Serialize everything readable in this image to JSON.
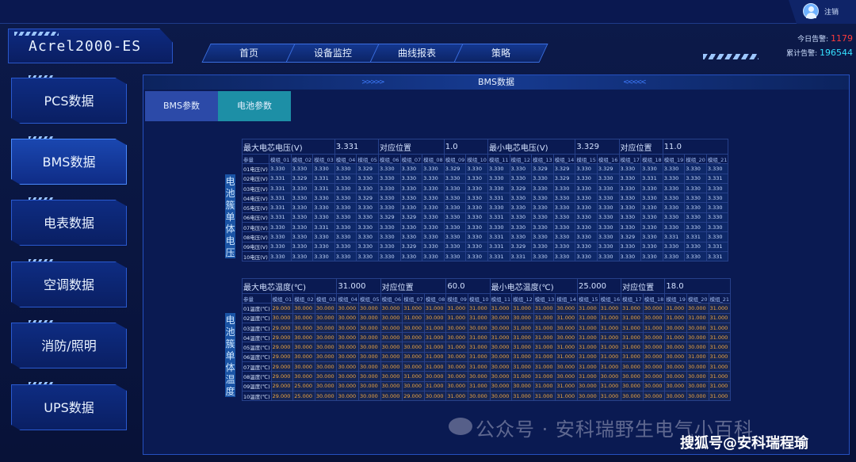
{
  "app": {
    "title": "Acrel2000-ES",
    "logout": "注销"
  },
  "nav": [
    "首页",
    "设备监控",
    "曲线报表",
    "策略"
  ],
  "alarms": {
    "today_label": "今日告警:",
    "today_value": "1179",
    "total_label": "累计告警:",
    "total_value": "196544"
  },
  "sidebar": [
    "PCS数据",
    "BMS数据",
    "电表数据",
    "空调数据",
    "消防/照明",
    "UPS数据"
  ],
  "sidebar_active": 1,
  "panel": {
    "title": "BMS数据",
    "tabs": [
      "BMS参数",
      "电池参数"
    ]
  },
  "voltage": {
    "vlabel": "电池簇单体电压",
    "summary": {
      "max_label": "最大电芯电压(V)",
      "max_value": "3.331",
      "max_pos_label": "对应位置",
      "max_pos": "1.0",
      "min_label": "最小电芯电压(V)",
      "min_value": "3.329",
      "min_pos_label": "对应位置",
      "min_pos": "11.0"
    },
    "corner": "参量",
    "columns": [
      "模组_01",
      "模组_02",
      "模组_03",
      "模组_04",
      "模组_05",
      "模组_06",
      "模组_07",
      "模组_08",
      "模组_09",
      "模组_10",
      "模组_11",
      "模组_12",
      "模组_13",
      "模组_14",
      "模组_15",
      "模组_16",
      "模组_17",
      "模组_18",
      "模组_19",
      "模组_20",
      "模组_21"
    ],
    "rows": [
      {
        "label": "01电压(V)",
        "values": [
          "3.330",
          "3.330",
          "3.330",
          "3.330",
          "3.329",
          "3.330",
          "3.330",
          "3.330",
          "3.329",
          "3.330",
          "3.330",
          "3.330",
          "3.329",
          "3.329",
          "3.330",
          "3.329",
          "3.330",
          "3.330",
          "3.330",
          "3.330",
          "3.330"
        ]
      },
      {
        "label": "02电压(V)",
        "values": [
          "3.331",
          "3.329",
          "3.331",
          "3.330",
          "3.330",
          "3.330",
          "3.330",
          "3.330",
          "3.330",
          "3.330",
          "3.330",
          "3.330",
          "3.330",
          "3.329",
          "3.330",
          "3.330",
          "3.330",
          "3.331",
          "3.330",
          "3.330",
          "3.331"
        ]
      },
      {
        "label": "03电压(V)",
        "values": [
          "3.331",
          "3.330",
          "3.331",
          "3.330",
          "3.330",
          "3.330",
          "3.330",
          "3.330",
          "3.330",
          "3.330",
          "3.330",
          "3.329",
          "3.330",
          "3.330",
          "3.330",
          "3.330",
          "3.330",
          "3.330",
          "3.330",
          "3.330",
          "3.330"
        ]
      },
      {
        "label": "04电压(V)",
        "values": [
          "3.331",
          "3.330",
          "3.330",
          "3.330",
          "3.329",
          "3.330",
          "3.330",
          "3.330",
          "3.330",
          "3.330",
          "3.331",
          "3.330",
          "3.330",
          "3.330",
          "3.330",
          "3.330",
          "3.330",
          "3.330",
          "3.330",
          "3.330",
          "3.330"
        ]
      },
      {
        "label": "05电压(V)",
        "values": [
          "3.331",
          "3.330",
          "3.330",
          "3.330",
          "3.330",
          "3.330",
          "3.330",
          "3.330",
          "3.330",
          "3.330",
          "3.330",
          "3.330",
          "3.330",
          "3.330",
          "3.330",
          "3.330",
          "3.330",
          "3.330",
          "3.330",
          "3.330",
          "3.330"
        ]
      },
      {
        "label": "06电压(V)",
        "values": [
          "3.331",
          "3.330",
          "3.330",
          "3.330",
          "3.330",
          "3.329",
          "3.329",
          "3.330",
          "3.330",
          "3.330",
          "3.331",
          "3.330",
          "3.330",
          "3.330",
          "3.330",
          "3.330",
          "3.330",
          "3.330",
          "3.330",
          "3.330",
          "3.330"
        ]
      },
      {
        "label": "07电压(V)",
        "values": [
          "3.330",
          "3.330",
          "3.331",
          "3.330",
          "3.330",
          "3.330",
          "3.330",
          "3.330",
          "3.330",
          "3.330",
          "3.330",
          "3.330",
          "3.330",
          "3.330",
          "3.330",
          "3.330",
          "3.330",
          "3.330",
          "3.330",
          "3.330",
          "3.330"
        ]
      },
      {
        "label": "08电压(V)",
        "values": [
          "3.330",
          "3.330",
          "3.330",
          "3.330",
          "3.330",
          "3.330",
          "3.330",
          "3.330",
          "3.330",
          "3.330",
          "3.331",
          "3.330",
          "3.330",
          "3.330",
          "3.330",
          "3.330",
          "3.329",
          "3.330",
          "3.331",
          "3.331",
          "3.330"
        ]
      },
      {
        "label": "09电压(V)",
        "values": [
          "3.330",
          "3.330",
          "3.330",
          "3.330",
          "3.330",
          "3.330",
          "3.329",
          "3.330",
          "3.330",
          "3.330",
          "3.331",
          "3.329",
          "3.330",
          "3.330",
          "3.330",
          "3.330",
          "3.330",
          "3.330",
          "3.330",
          "3.330",
          "3.331"
        ]
      },
      {
        "label": "10电压(V)",
        "values": [
          "3.330",
          "3.330",
          "3.330",
          "3.330",
          "3.330",
          "3.330",
          "3.330",
          "3.330",
          "3.330",
          "3.330",
          "3.331",
          "3.331",
          "3.330",
          "3.330",
          "3.330",
          "3.330",
          "3.330",
          "3.330",
          "3.330",
          "3.330",
          "3.331"
        ]
      }
    ]
  },
  "temperature": {
    "vlabel": "电池簇单体温度",
    "summary": {
      "max_label": "最大电芯温度(℃)",
      "max_value": "31.000",
      "max_pos_label": "对应位置",
      "max_pos": "60.0",
      "min_label": "最小电芯温度(℃)",
      "min_value": "25.000",
      "min_pos_label": "对应位置",
      "min_pos": "18.0"
    },
    "corner": "参量",
    "columns": [
      "模组_01",
      "模组_02",
      "模组_03",
      "模组_04",
      "模组_05",
      "模组_06",
      "模组_07",
      "模组_08",
      "模组_09",
      "模组_10",
      "模组_11",
      "模组_12",
      "模组_13",
      "模组_14",
      "模组_15",
      "模组_16",
      "模组_17",
      "模组_18",
      "模组_19",
      "模组_20",
      "模组_21"
    ],
    "rows": [
      {
        "label": "01温度(℃)",
        "values": [
          "29.000",
          "30.000",
          "30.000",
          "30.000",
          "30.000",
          "30.000",
          "31.000",
          "31.000",
          "31.000",
          "31.000",
          "31.000",
          "31.000",
          "31.000",
          "30.000",
          "31.000",
          "31.000",
          "31.000",
          "30.000",
          "31.000",
          "30.000",
          "31.000"
        ]
      },
      {
        "label": "02温度(℃)",
        "values": [
          "30.000",
          "30.000",
          "30.000",
          "30.000",
          "30.000",
          "30.000",
          "31.000",
          "30.000",
          "31.000",
          "31.000",
          "30.000",
          "30.000",
          "31.000",
          "31.000",
          "31.000",
          "31.000",
          "31.000",
          "30.000",
          "31.000",
          "31.000",
          "31.000"
        ]
      },
      {
        "label": "03温度(℃)",
        "values": [
          "29.000",
          "30.000",
          "30.000",
          "30.000",
          "30.000",
          "30.000",
          "30.000",
          "31.000",
          "30.000",
          "30.000",
          "30.000",
          "31.000",
          "31.000",
          "30.000",
          "31.000",
          "31.000",
          "31.000",
          "31.000",
          "30.000",
          "30.000",
          "31.000"
        ]
      },
      {
        "label": "04温度(℃)",
        "values": [
          "29.000",
          "30.000",
          "30.000",
          "30.000",
          "30.000",
          "30.000",
          "30.000",
          "31.000",
          "30.000",
          "31.000",
          "31.000",
          "31.000",
          "31.000",
          "30.000",
          "31.000",
          "31.000",
          "31.000",
          "30.000",
          "31.000",
          "30.000",
          "31.000"
        ]
      },
      {
        "label": "05温度(℃)",
        "values": [
          "29.000",
          "30.000",
          "30.000",
          "30.000",
          "30.000",
          "30.000",
          "30.000",
          "31.000",
          "31.000",
          "31.000",
          "30.000",
          "31.000",
          "31.000",
          "31.000",
          "31.000",
          "31.000",
          "31.000",
          "30.000",
          "30.000",
          "30.000",
          "31.000"
        ]
      },
      {
        "label": "06温度(℃)",
        "values": [
          "29.000",
          "30.000",
          "30.000",
          "30.000",
          "30.000",
          "30.000",
          "30.000",
          "31.000",
          "30.000",
          "31.000",
          "30.000",
          "31.000",
          "31.000",
          "31.000",
          "31.000",
          "31.000",
          "31.000",
          "30.000",
          "30.000",
          "31.000",
          "31.000"
        ]
      },
      {
        "label": "07温度(℃)",
        "values": [
          "29.000",
          "30.000",
          "30.000",
          "30.000",
          "30.000",
          "30.000",
          "30.000",
          "31.000",
          "30.000",
          "31.000",
          "30.000",
          "31.000",
          "31.000",
          "30.000",
          "31.000",
          "31.000",
          "30.000",
          "30.000",
          "30.000",
          "30.000",
          "31.000"
        ]
      },
      {
        "label": "08温度(℃)",
        "values": [
          "29.000",
          "30.000",
          "30.000",
          "30.000",
          "30.000",
          "30.000",
          "31.000",
          "30.000",
          "30.000",
          "30.000",
          "30.000",
          "31.000",
          "31.000",
          "30.000",
          "31.000",
          "30.000",
          "30.000",
          "30.000",
          "30.000",
          "30.000",
          "31.000"
        ]
      },
      {
        "label": "09温度(℃)",
        "values": [
          "29.000",
          "25.000",
          "30.000",
          "30.000",
          "30.000",
          "30.000",
          "30.000",
          "31.000",
          "30.000",
          "31.000",
          "30.000",
          "30.000",
          "31.000",
          "31.000",
          "30.000",
          "31.000",
          "30.000",
          "30.000",
          "30.000",
          "30.000",
          "31.000"
        ]
      },
      {
        "label": "10温度(℃)",
        "values": [
          "29.000",
          "25.000",
          "30.000",
          "30.000",
          "30.000",
          "30.000",
          "29.000",
          "30.000",
          "31.000",
          "30.000",
          "30.000",
          "31.000",
          "31.000",
          "31.000",
          "30.000",
          "31.000",
          "30.000",
          "30.000",
          "30.000",
          "30.000",
          "31.000"
        ]
      }
    ]
  },
  "watermark": {
    "text": "公众号 · 安科瑞野生电气小百科",
    "credit": "搜狐号@安科瑞程瑜"
  }
}
